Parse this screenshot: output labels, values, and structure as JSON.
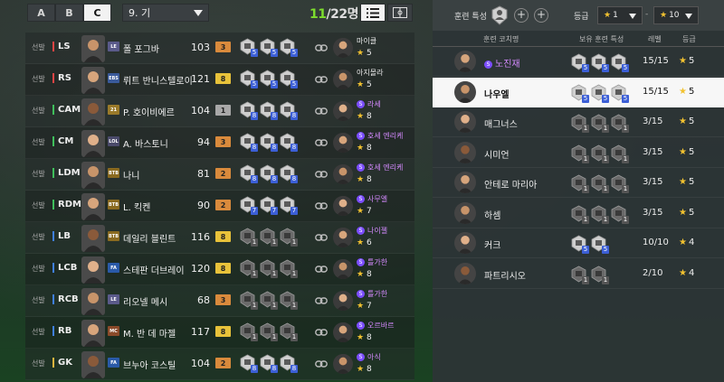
{
  "squad_tabs": [
    "A",
    "B",
    "C"
  ],
  "active_squad": "C",
  "formation": "9. 기",
  "player_count": {
    "current": "11",
    "total": "/22명"
  },
  "starter_label": "선발",
  "players": [
    {
      "pos": "LS",
      "season": "LE",
      "name": "폴 포그바",
      "ovr": "103",
      "grade": "3",
      "traits": [
        "5",
        "5",
        "5"
      ],
      "coach": "마이클",
      "coach_grade": "5",
      "premium": false
    },
    {
      "pos": "RS",
      "season": "EBS",
      "name": "뤼트 반니스텔로이",
      "ovr": "121",
      "grade": "8",
      "traits": [
        "5",
        "5",
        "5"
      ],
      "coach": "아지몰라",
      "coach_grade": "5",
      "premium": false
    },
    {
      "pos": "CAM",
      "season": "21",
      "name": "P. 호이비에르",
      "ovr": "104",
      "grade": "1",
      "traits": [
        "8",
        "8",
        "8"
      ],
      "coach": "라세",
      "coach_grade": "8",
      "premium": true
    },
    {
      "pos": "CM",
      "season": "LOL",
      "name": "A. 바스토니",
      "ovr": "94",
      "grade": "3",
      "traits": [
        "8",
        "8",
        "8"
      ],
      "coach": "호세 엔리케",
      "coach_grade": "8",
      "premium": true
    },
    {
      "pos": "LDM",
      "season": "BTB",
      "name": "나니",
      "ovr": "81",
      "grade": "2",
      "traits": [
        "8",
        "8",
        "8"
      ],
      "coach": "호세 엔리케",
      "coach_grade": "8",
      "premium": true
    },
    {
      "pos": "RDM",
      "season": "BTB",
      "name": "L. 킥켄",
      "ovr": "90",
      "grade": "2",
      "traits": [
        "7",
        "7",
        "7"
      ],
      "coach": "사무엘",
      "coach_grade": "7",
      "premium": true
    },
    {
      "pos": "LB",
      "season": "BTB",
      "name": "데일리 블린트",
      "ovr": "116",
      "grade": "8",
      "traits": [
        "1",
        "1",
        "1"
      ],
      "coach": "나이젤",
      "coach_grade": "6",
      "premium": true
    },
    {
      "pos": "LCB",
      "season": "FA",
      "name": "스테판 더브레이",
      "ovr": "120",
      "grade": "8",
      "traits": [
        "1",
        "1",
        "1"
      ],
      "coach": "틀가한",
      "coach_grade": "8",
      "premium": true
    },
    {
      "pos": "RCB",
      "season": "LE",
      "name": "리오넬 메시",
      "ovr": "68",
      "grade": "3",
      "traits": [
        "1",
        "1",
        "1"
      ],
      "coach": "틀가한",
      "coach_grade": "7",
      "premium": true
    },
    {
      "pos": "RB",
      "season": "MC",
      "name": "M. 반 데 마젤",
      "ovr": "117",
      "grade": "8",
      "traits": [
        "1",
        "1",
        "1"
      ],
      "coach": "오르바르",
      "coach_grade": "8",
      "premium": true
    },
    {
      "pos": "GK",
      "season": "FA",
      "name": "브누아 코스틸",
      "ovr": "104",
      "grade": "2",
      "traits": [
        "8",
        "8",
        "8"
      ],
      "coach": "아식",
      "coach_grade": "8",
      "premium": true
    }
  ],
  "right_panel": {
    "train_label": "훈련 특성",
    "grade_label": "등급",
    "grade_min": "1",
    "grade_max": "10",
    "dash": "-",
    "headers": {
      "name": "훈련 코치명",
      "traits": "보유 훈련 특성",
      "level": "레벨",
      "grade": "등급"
    },
    "coaches": [
      {
        "name": "노진재",
        "traits": [
          "5",
          "5",
          "5"
        ],
        "level": "15/15",
        "grade": "5",
        "premium": true,
        "selected": false
      },
      {
        "name": "나우엘",
        "traits": [
          "5",
          "5",
          "5"
        ],
        "level": "15/15",
        "grade": "5",
        "premium": false,
        "selected": true
      },
      {
        "name": "매그너스",
        "traits": [
          "1",
          "1",
          "1"
        ],
        "level": "3/15",
        "grade": "5",
        "premium": false,
        "selected": false
      },
      {
        "name": "시미언",
        "traits": [
          "1",
          "1",
          "1"
        ],
        "level": "3/15",
        "grade": "5",
        "premium": false,
        "selected": false
      },
      {
        "name": "안테로 마리아",
        "traits": [
          "1",
          "1",
          "1"
        ],
        "level": "3/15",
        "grade": "5",
        "premium": false,
        "selected": false
      },
      {
        "name": "하셈",
        "traits": [
          "1",
          "1",
          "1"
        ],
        "level": "3/15",
        "grade": "5",
        "premium": false,
        "selected": false
      },
      {
        "name": "커크",
        "traits": [
          "5",
          "5"
        ],
        "level": "10/10",
        "grade": "4",
        "premium": false,
        "selected": false
      },
      {
        "name": "파트리시오",
        "traits": [
          "1",
          "1"
        ],
        "level": "2/10",
        "grade": "4",
        "premium": false,
        "selected": false
      }
    ]
  },
  "colors": {
    "accent_green": "#7ddc2e",
    "star": "#f2c230",
    "premium": "#d58aff",
    "grade_orange": "#d98a3c",
    "grade_gold": "#e8c23a",
    "grade_gray": "#a8a8a8"
  }
}
